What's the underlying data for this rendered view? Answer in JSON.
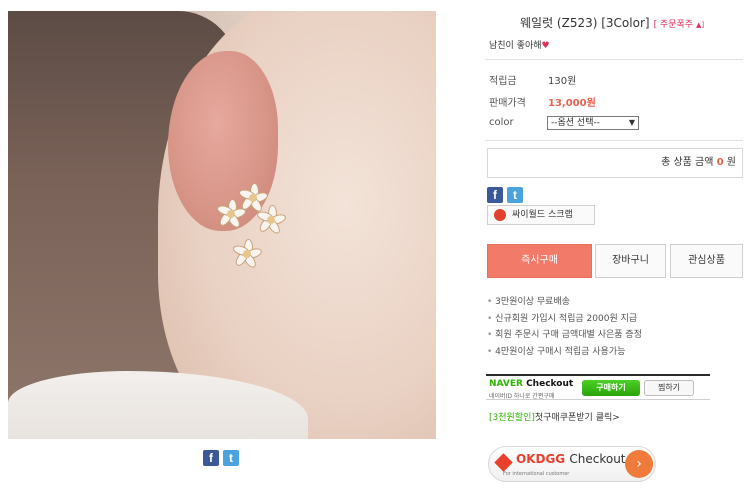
{
  "product": {
    "title": "웨일럿 (Z523) [3Color]",
    "review_label": "[ 주문폭주",
    "review_arrow": "▲]",
    "subtitle": "남친이 좋아해",
    "subtitle_heart": "♥"
  },
  "info": {
    "points_label": "적립금",
    "points_value": "130원",
    "price_label": "판매가격",
    "price_value": "13,000원",
    "color_label": "color",
    "option_select": "--옵션 선택--",
    "option_caret": "▼"
  },
  "total": {
    "label": "총 상품 금액",
    "amount": "0",
    "unit": "원"
  },
  "share": {
    "facebook_glyph": "f",
    "twitter_glyph": "t"
  },
  "scrap_label": "싸이월드 스크랩",
  "buttons": {
    "buy_now": "즉시구매",
    "cart": "장바구니",
    "wishlist": "관심상품"
  },
  "benefits": [
    "3만원이상 무료배송",
    "신규회원 가입시 적립금 2000원 지급",
    "회원 주문시 구매 금액대별 사은품 증정",
    "4만원이상 구매시 적립금 사용가능"
  ],
  "naver": {
    "brand": "NAVER",
    "brand_suffix": "Checkout",
    "desc": "네이버ID 하나로 간편구매",
    "buy": "구매하기",
    "zzim": "찜하기"
  },
  "coupon": {
    "tag": "[3천원할인]",
    "text": "첫구매쿠폰받기 클릭>"
  },
  "okdgg": {
    "brand": "OKDGG",
    "brand_suffix": "Checkout",
    "desc": "For international customer",
    "go_arrow": "›"
  },
  "colors": {
    "accent_price": "#e8614d",
    "buy_button": "#f27a68",
    "naver_green": "#2cb400",
    "review_pink": "#e0315c"
  }
}
